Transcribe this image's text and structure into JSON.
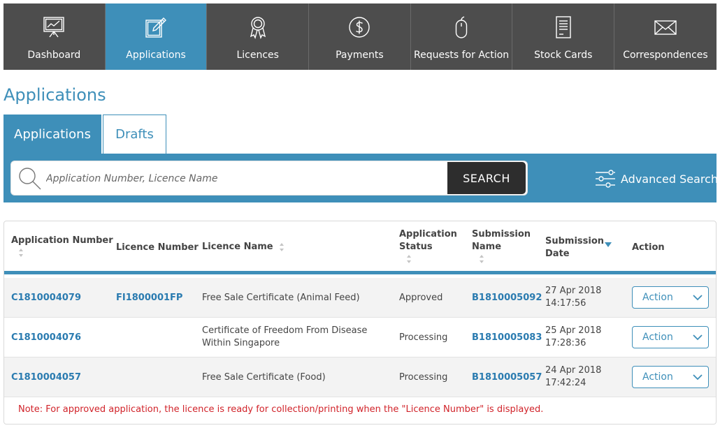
{
  "nav": {
    "items": [
      {
        "label": "Dashboard"
      },
      {
        "label": "Applications"
      },
      {
        "label": "Licences"
      },
      {
        "label": "Payments"
      },
      {
        "label": "Requests for Action"
      },
      {
        "label": "Stock Cards"
      },
      {
        "label": "Correspondences"
      }
    ]
  },
  "page": {
    "title": "Applications"
  },
  "tabs": [
    {
      "label": "Applications"
    },
    {
      "label": "Drafts"
    }
  ],
  "search": {
    "placeholder": "Application Number, Licence Name",
    "button_label": "SEARCH",
    "advanced_label": "Advanced Search"
  },
  "table": {
    "headers": {
      "application_number": "Application Number",
      "licence_number": "Licence Number",
      "licence_name": "Licence Name",
      "status_line1": "Application",
      "status_line2": "Status",
      "submission_name_line1": "Submission",
      "submission_name_line2": "Name",
      "submission_date_line1": "Submission",
      "submission_date_line2": "Date",
      "action": "Action"
    },
    "rows": [
      {
        "application_number": "C1810004079",
        "licence_number": "FI1800001FP",
        "licence_name_line1": "Free Sale Certificate (Animal Feed)",
        "licence_name_line2": "",
        "status": "Approved",
        "submission_name": "B1810005092",
        "date": "27 Apr 2018",
        "time": "14:17:56",
        "action": "Action"
      },
      {
        "application_number": "C1810004076",
        "licence_number": "",
        "licence_name_line1": "Certificate of Freedom From Disease",
        "licence_name_line2": "Within Singapore",
        "status": "Processing",
        "submission_name": "B1810005083",
        "date": "25 Apr 2018",
        "time": "17:28:36",
        "action": "Action"
      },
      {
        "application_number": "C1810004057",
        "licence_number": "",
        "licence_name_line1": "Free Sale Certificate (Food)",
        "licence_name_line2": "",
        "status": "Processing",
        "submission_name": "B1810005057",
        "date": "24 Apr 2018",
        "time": "17:42:24",
        "action": "Action"
      }
    ],
    "note": "Note: For approved application, the licence is ready for collection/printing when the \"Licence Number\" is displayed."
  },
  "colors": {
    "accent": "#3e8fb9",
    "nav_bg": "#4d4d4d",
    "link": "#2a7bb0",
    "note": "#d1232a"
  },
  "icons": [
    "presentation-board-icon",
    "edit-form-icon",
    "award-ribbon-icon",
    "dollar-coin-icon",
    "mouse-icon",
    "document-list-icon",
    "envelope-icon",
    "search-icon",
    "filter-sliders-icon",
    "sort-icon",
    "chevron-down-icon"
  ]
}
